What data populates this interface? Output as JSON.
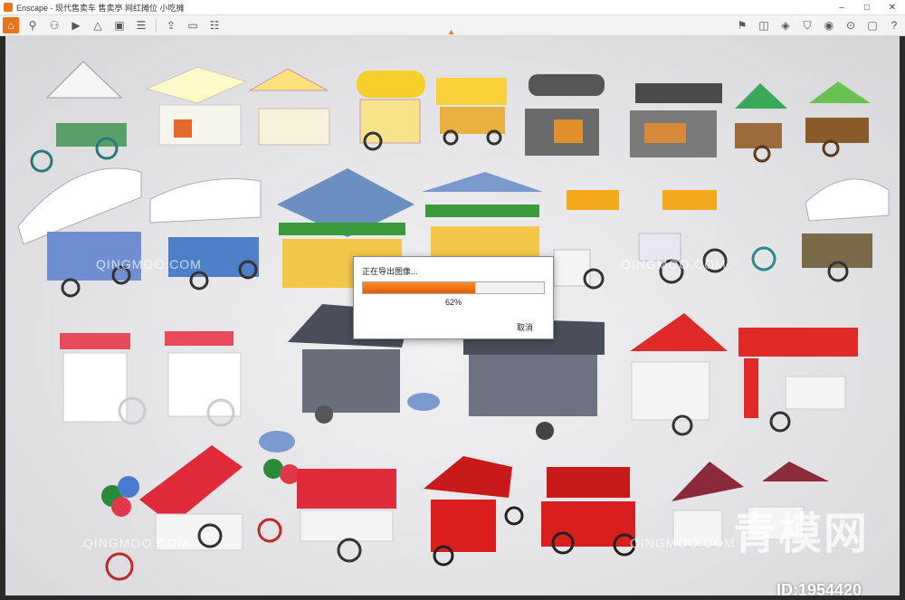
{
  "window": {
    "title": "Enscape - 现代售卖车 售卖亭 网红摊位 小吃摊",
    "minimize": "–",
    "maximize": "□",
    "close": "✕"
  },
  "toolbar": {
    "left_icons": [
      "home-icon",
      "link-icon",
      "collab-icon",
      "video-icon",
      "landscape-icon",
      "export-icon",
      "asset-icon",
      "view-icon",
      "settings-icon",
      "monitor-icon"
    ],
    "right_icons": [
      "pin-icon",
      "panorama-icon",
      "box-icon",
      "asset-library-icon",
      "material-icon",
      "vr-icon",
      "camera-icon",
      "help-icon"
    ]
  },
  "dialog": {
    "title": "正在导出图像...",
    "progress": 0.62,
    "percent_label": "62%",
    "cancel_label": "取消"
  },
  "watermarks": {
    "brand_big": "青模网",
    "id_label": "ID:1954420",
    "tile_text": "QINGMOO.COM"
  },
  "colors": {
    "accent": "#e8731a",
    "progress": "#e25d00"
  }
}
